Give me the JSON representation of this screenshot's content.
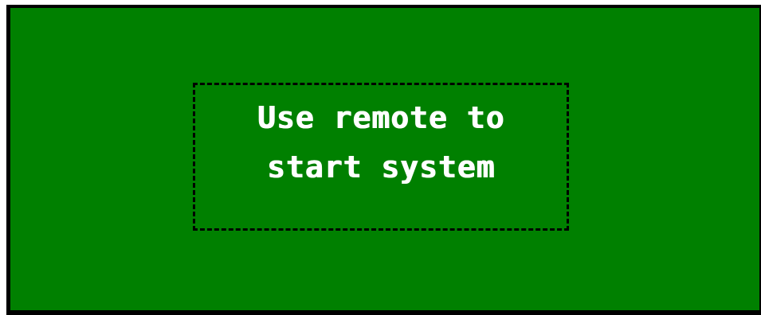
{
  "screen": {
    "background_color": "#008000",
    "message_lines": [
      "Use remote to",
      "start system"
    ]
  }
}
